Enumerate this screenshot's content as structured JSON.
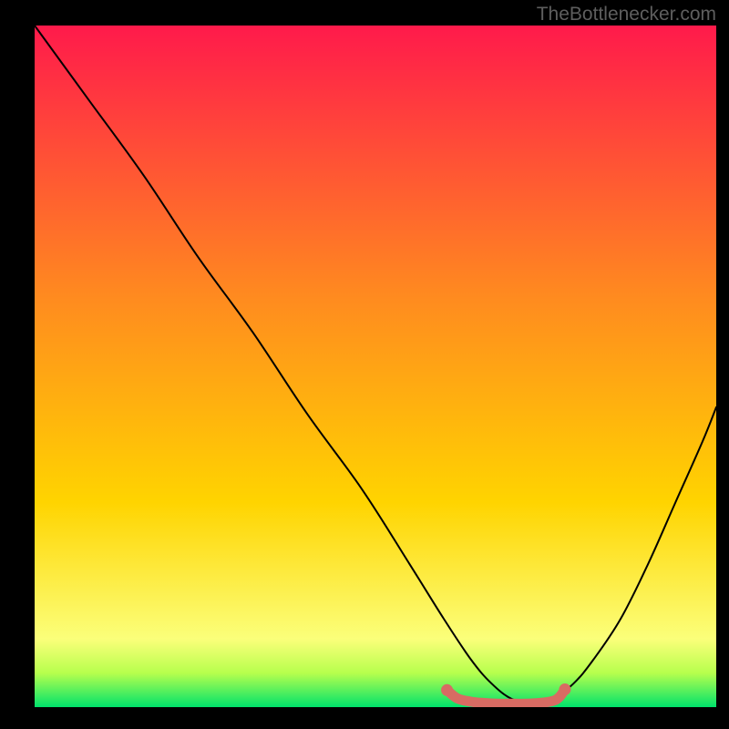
{
  "watermark": "TheBottlenecker.com",
  "chart_data": {
    "type": "line",
    "title": "",
    "xlabel": "",
    "ylabel": "",
    "xlim": [
      0,
      100
    ],
    "ylim": [
      0,
      100
    ],
    "background_gradient": {
      "top": "#ff1a4b",
      "mid": "#ffd400",
      "bottom": "#00e26b",
      "band_top": "#fbff7a",
      "band_low": "#b7ff4d"
    },
    "series": [
      {
        "name": "curve",
        "stroke": "#000000",
        "x": [
          0,
          8,
          16,
          24,
          32,
          40,
          48,
          55,
          60,
          64,
          67,
          70,
          73,
          76,
          79,
          82,
          86,
          90,
          94,
          98,
          100
        ],
        "values": [
          100,
          89,
          78,
          66,
          55,
          43,
          32,
          21,
          13,
          7,
          3.5,
          1.2,
          0.6,
          1.3,
          3.4,
          7,
          13,
          21,
          30,
          39,
          44
        ]
      },
      {
        "name": "bottom-marker",
        "stroke": "#d86b63",
        "x": [
          60.5,
          62,
          64,
          66,
          68,
          70,
          72,
          74,
          76,
          77,
          77.8
        ],
        "values": [
          2.5,
          1.3,
          0.8,
          0.6,
          0.5,
          0.5,
          0.5,
          0.6,
          0.9,
          1.5,
          2.6
        ]
      }
    ],
    "marker_endpoints": {
      "left": {
        "x": 60.5,
        "y": 2.5
      },
      "right": {
        "x": 77.8,
        "y": 2.6
      }
    }
  }
}
